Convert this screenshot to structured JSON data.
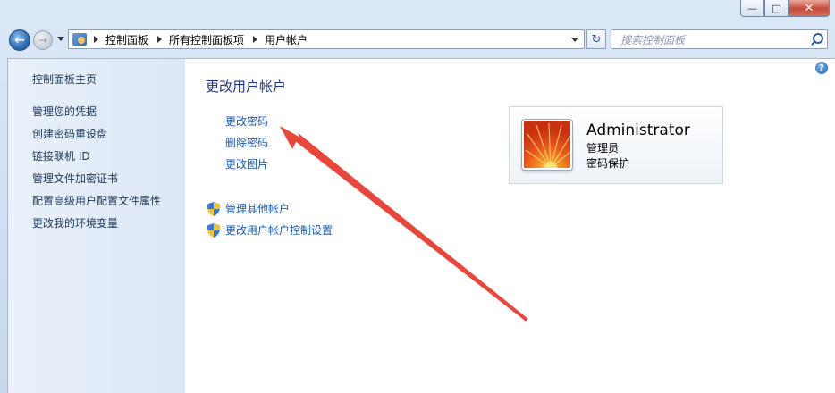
{
  "window": {
    "caption_buttons": {
      "minimize": "—",
      "maximize": "□",
      "close": "✕"
    }
  },
  "navbar": {
    "breadcrumbs": [
      "控制面板",
      "所有控制面板项",
      "用户帐户"
    ],
    "search_placeholder": "搜索控制面板"
  },
  "sidebar": {
    "home": "控制面板主页",
    "items": [
      "管理您的凭据",
      "创建密码重设盘",
      "链接联机 ID",
      "管理文件加密证书",
      "配置高级用户配置文件属性",
      "更改我的环境变量"
    ]
  },
  "main": {
    "title": "更改用户帐户",
    "tasks": [
      "更改密码",
      "删除密码",
      "更改图片"
    ],
    "shield_tasks": [
      "管理其他帐户",
      "更改用户帐户控制设置"
    ],
    "help_glyph": "?"
  },
  "account": {
    "name": "Administrator",
    "role": "管理员",
    "status": "密码保护"
  },
  "icons": {
    "back": "back-arrow-icon",
    "forward": "forward-arrow-icon",
    "refresh": "refresh-icon",
    "search": "search-icon",
    "shield": "uac-shield-icon"
  },
  "colors": {
    "link": "#1e5bb0",
    "title": "#1e3287",
    "annotation_arrow": "#e8473a"
  }
}
